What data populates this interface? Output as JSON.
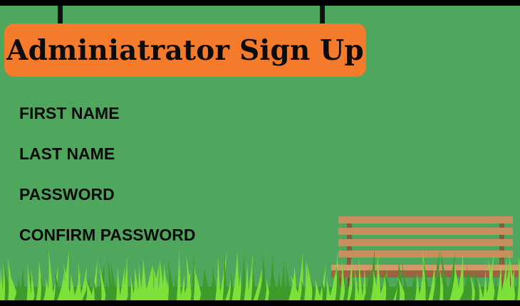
{
  "page": {
    "title": "Adminiatrator Sign Up"
  },
  "form": {
    "first_name_label": "FIRST NAME",
    "last_name_label": "LAST NAME",
    "password_label": "PASSWORD",
    "confirm_password_label": "CONFIRM PASSWORD"
  },
  "colors": {
    "background": "#4fa75d",
    "frame": "#000000",
    "title_sign": "#f47a2c",
    "text": "#0a0a0a",
    "bench_wood": "#c98e5e",
    "bench_frame": "#8a5a3a",
    "grass_light": "#7be03a",
    "grass_dark": "#3d9b2a"
  },
  "icons": {
    "bench": "park-bench-illustration",
    "grass": "grass-illustration"
  }
}
